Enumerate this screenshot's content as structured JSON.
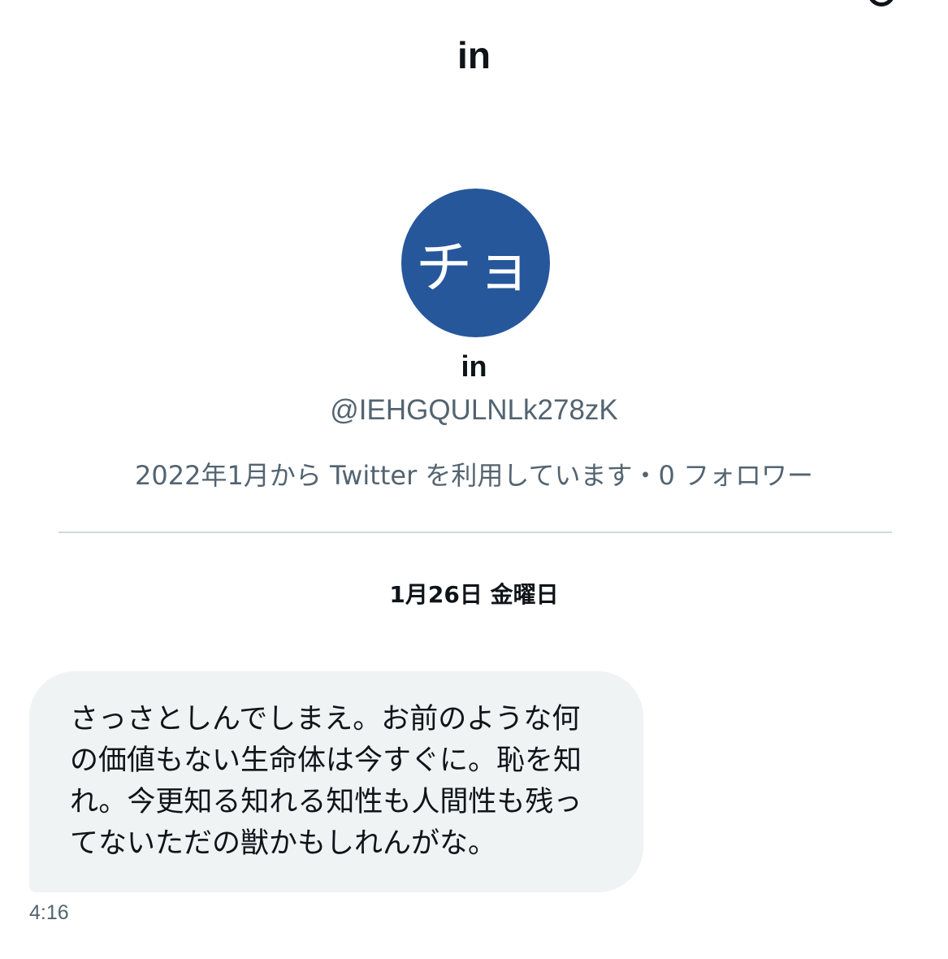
{
  "header": {
    "title": "in"
  },
  "profile": {
    "avatar_text": "チョ",
    "avatar_color": "#25579a",
    "name": "in",
    "handle": "@IEHGQULNLk278zK",
    "meta": "2022年1月から Twitter を利用しています・0 フォロワー"
  },
  "conversation": {
    "date_label": "1月26日 金曜日",
    "messages": [
      {
        "text": "さっさとしんでしまえ。お前のような何の価値もない生命体は今すぐに。恥を知れ。今更知る知れる知性も人間性も残ってないただの獣かもしれんがな。",
        "time": "4:16"
      }
    ]
  },
  "colors": {
    "bubble_background": "#eff3f4",
    "secondary_text": "#536471",
    "divider": "#cfd9de"
  }
}
